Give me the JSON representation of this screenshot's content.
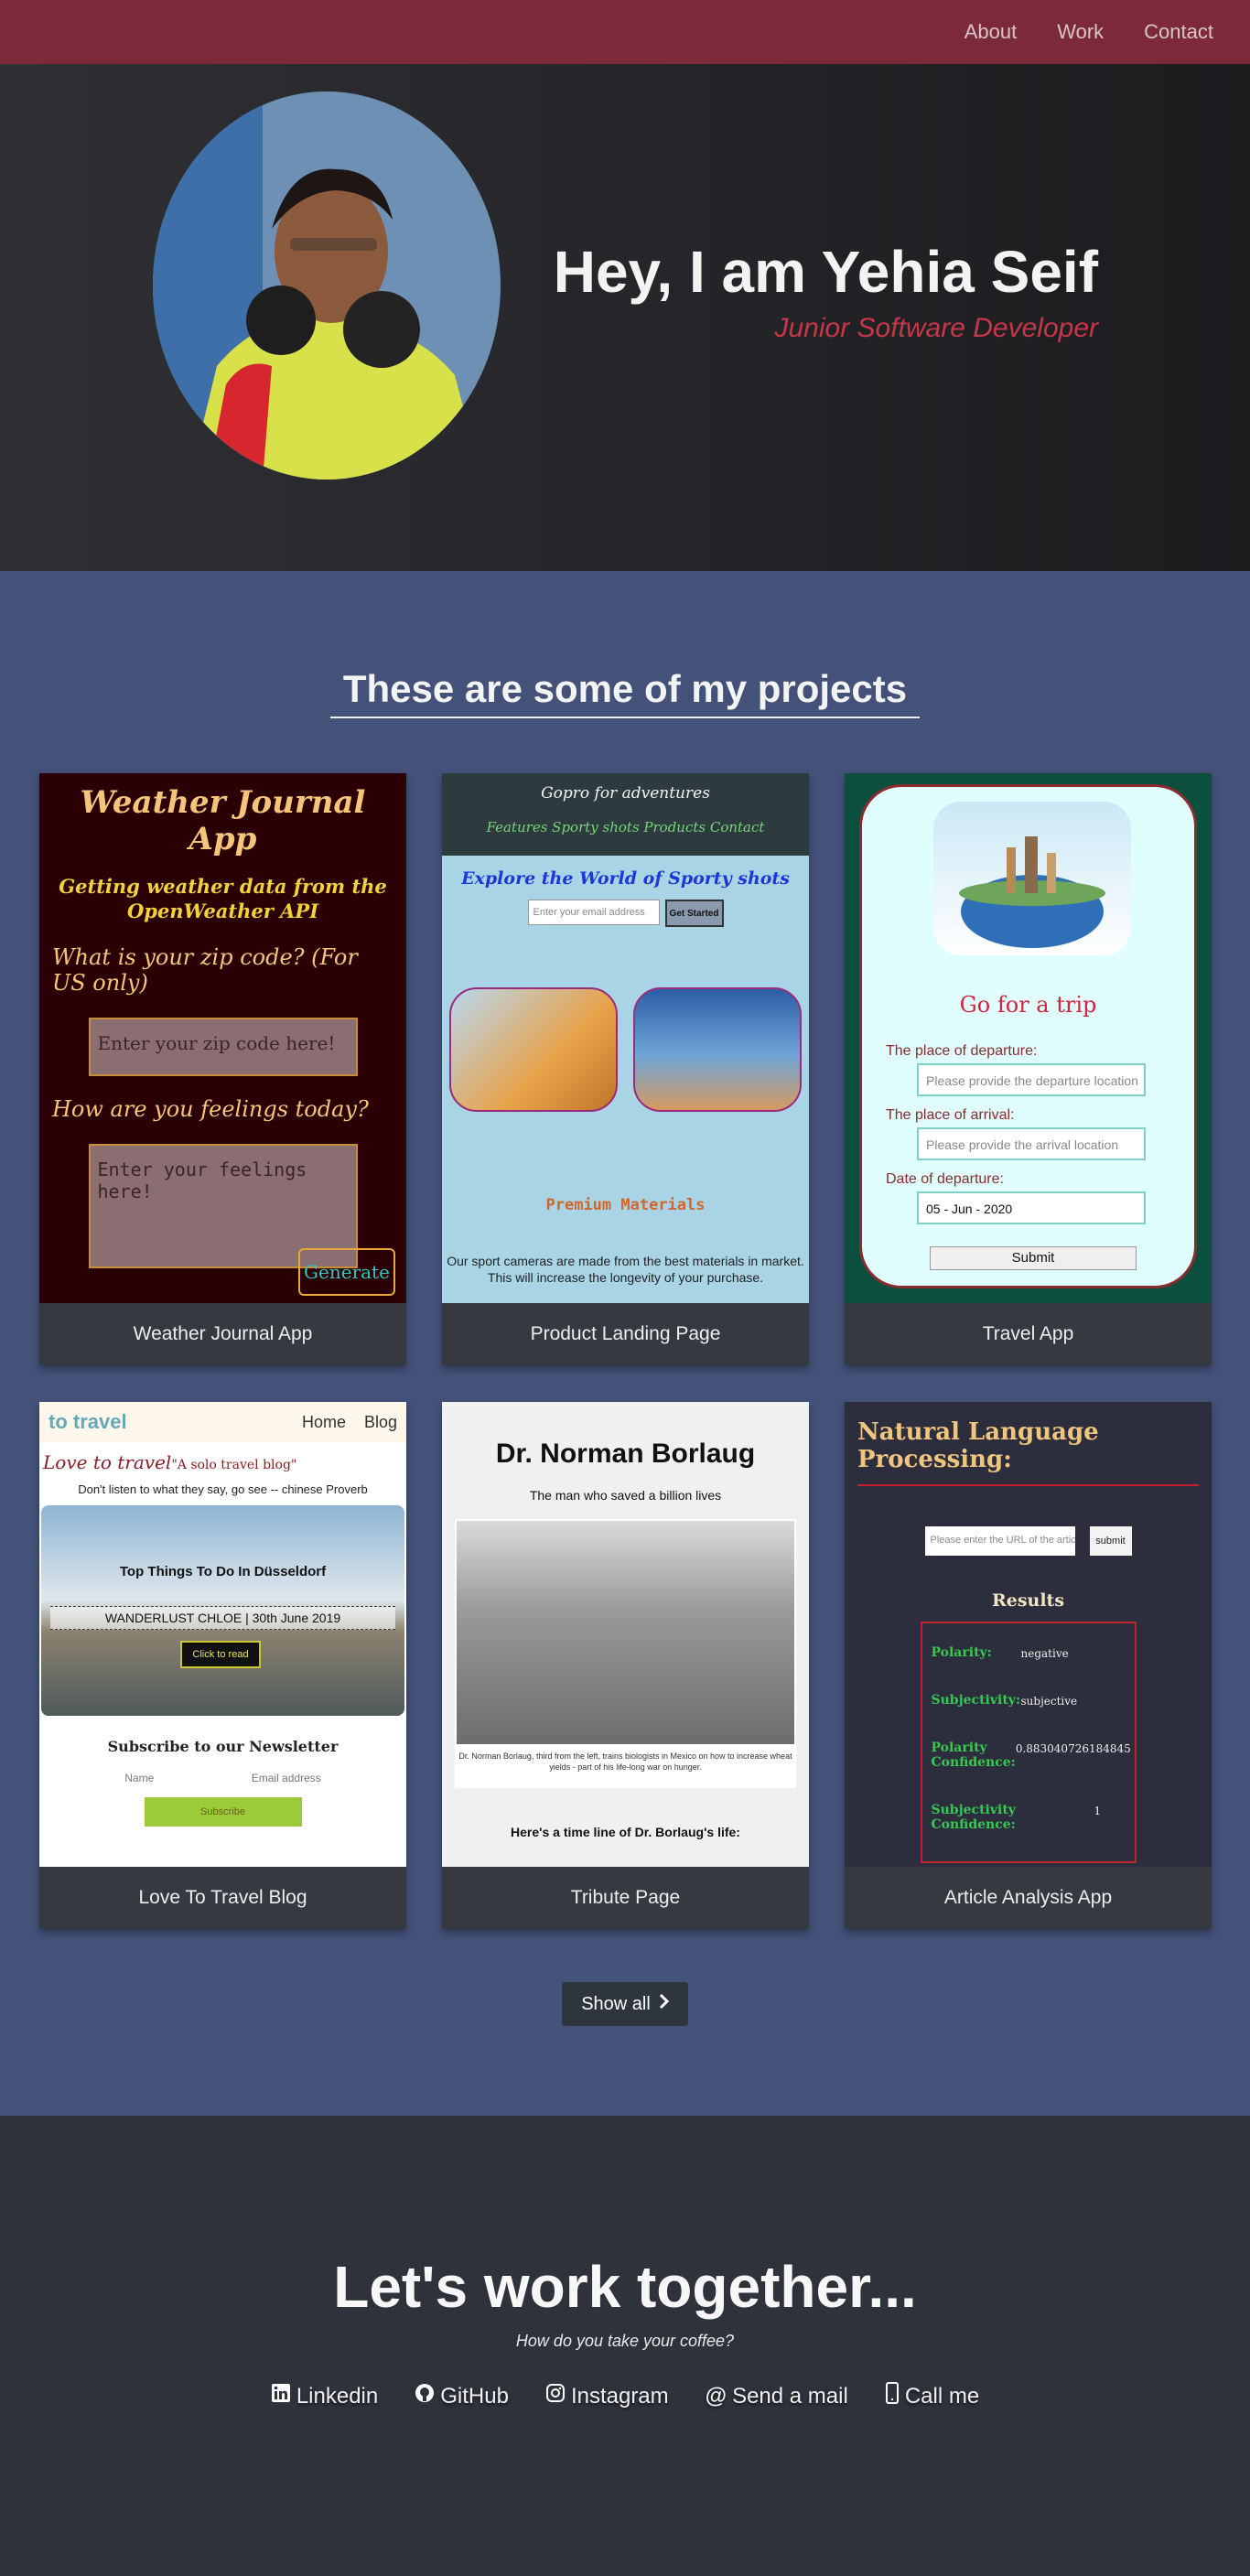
{
  "nav": {
    "items": [
      "About",
      "Work",
      "Contact"
    ]
  },
  "hero": {
    "name": "Hey, I am Yehia Seif",
    "role": "Junior Software Developer"
  },
  "projects": {
    "title": "These are some of my projects",
    "show_all": "Show all",
    "cards": [
      {
        "caption": "Weather Journal App"
      },
      {
        "caption": "Product Landing Page"
      },
      {
        "caption": "Travel App"
      },
      {
        "caption": "Love To Travel Blog"
      },
      {
        "caption": "Tribute Page"
      },
      {
        "caption": "Article Analysis App"
      }
    ],
    "weather": {
      "title": "Weather Journal App",
      "subtitle": "Getting weather data from the OpenWeather API",
      "zip_q": "What is your zip code? (For US only)",
      "zip_placeholder": "Enter your zip code here!",
      "feel_q": "How are you feelings today?",
      "feel_placeholder": "Enter your feelings here!",
      "button": "Generate"
    },
    "product": {
      "brand": "Gopro for adventures",
      "links": "Features  Sporty shots  Products  Contact",
      "hero": "Explore the World of Sporty shots",
      "email_placeholder": "Enter your email address",
      "button": "Get Started",
      "premium": "Premium Materials",
      "text": "Our sport cameras are made from the best materials in market. This will increase the longevity of your purchase."
    },
    "travel": {
      "heading": "Go for a trip",
      "dep_label": "The place of departure:",
      "dep_placeholder": "Please provide the departure location",
      "arr_label": "The place of arrival:",
      "arr_placeholder": "Please provide the arrival location",
      "date_label": "Date of departure:",
      "date_value": "05 - Jun - 2020",
      "submit": "Submit"
    },
    "blog": {
      "logo": "to travel",
      "links": [
        "Home",
        "Blog"
      ],
      "tagline": "Love to travel",
      "tagline2": "\"A solo travel blog\"",
      "quote": "Don't listen to what they say, go see -- chinese Proverb",
      "post_title": "Top Things To Do In Düsseldorf",
      "post_meta": "WANDERLUST CHLOE | 30th June 2019",
      "read": "Click to read",
      "newsletter": "Subscribe to our Newsletter",
      "name": "Name",
      "email": "Email address",
      "subscribe": "Subscribe"
    },
    "tribute": {
      "title": "Dr. Norman Borlaug",
      "subtitle": "The man who saved a billion lives",
      "caption": "Dr. Norman Borlaug, third from the left, trains biologists in Mexico on how to increase wheat yields - part of his life-long war on hunger.",
      "timeline": "Here's a time line of Dr. Borlaug's life:"
    },
    "nlp": {
      "title": "Natural Language Processing:",
      "url_placeholder": "Please enter the URL of the article",
      "submit": "submit",
      "results": "Results",
      "polarity_k": "Polarity:",
      "polarity_v": "negative",
      "subj_k": "Subjectivity:",
      "subj_v": "subjective",
      "pc_k": "Polarity Confidence:",
      "pc_v": "0.883040726184845",
      "sc_k": "Subjectivity Confidence:",
      "sc_v": "1"
    }
  },
  "contact": {
    "title": "Let's work together...",
    "subtitle": "How do you take your coffee?",
    "links": [
      "Linkedin",
      "GitHub",
      "Instagram",
      "Send a mail",
      "Call me"
    ]
  }
}
